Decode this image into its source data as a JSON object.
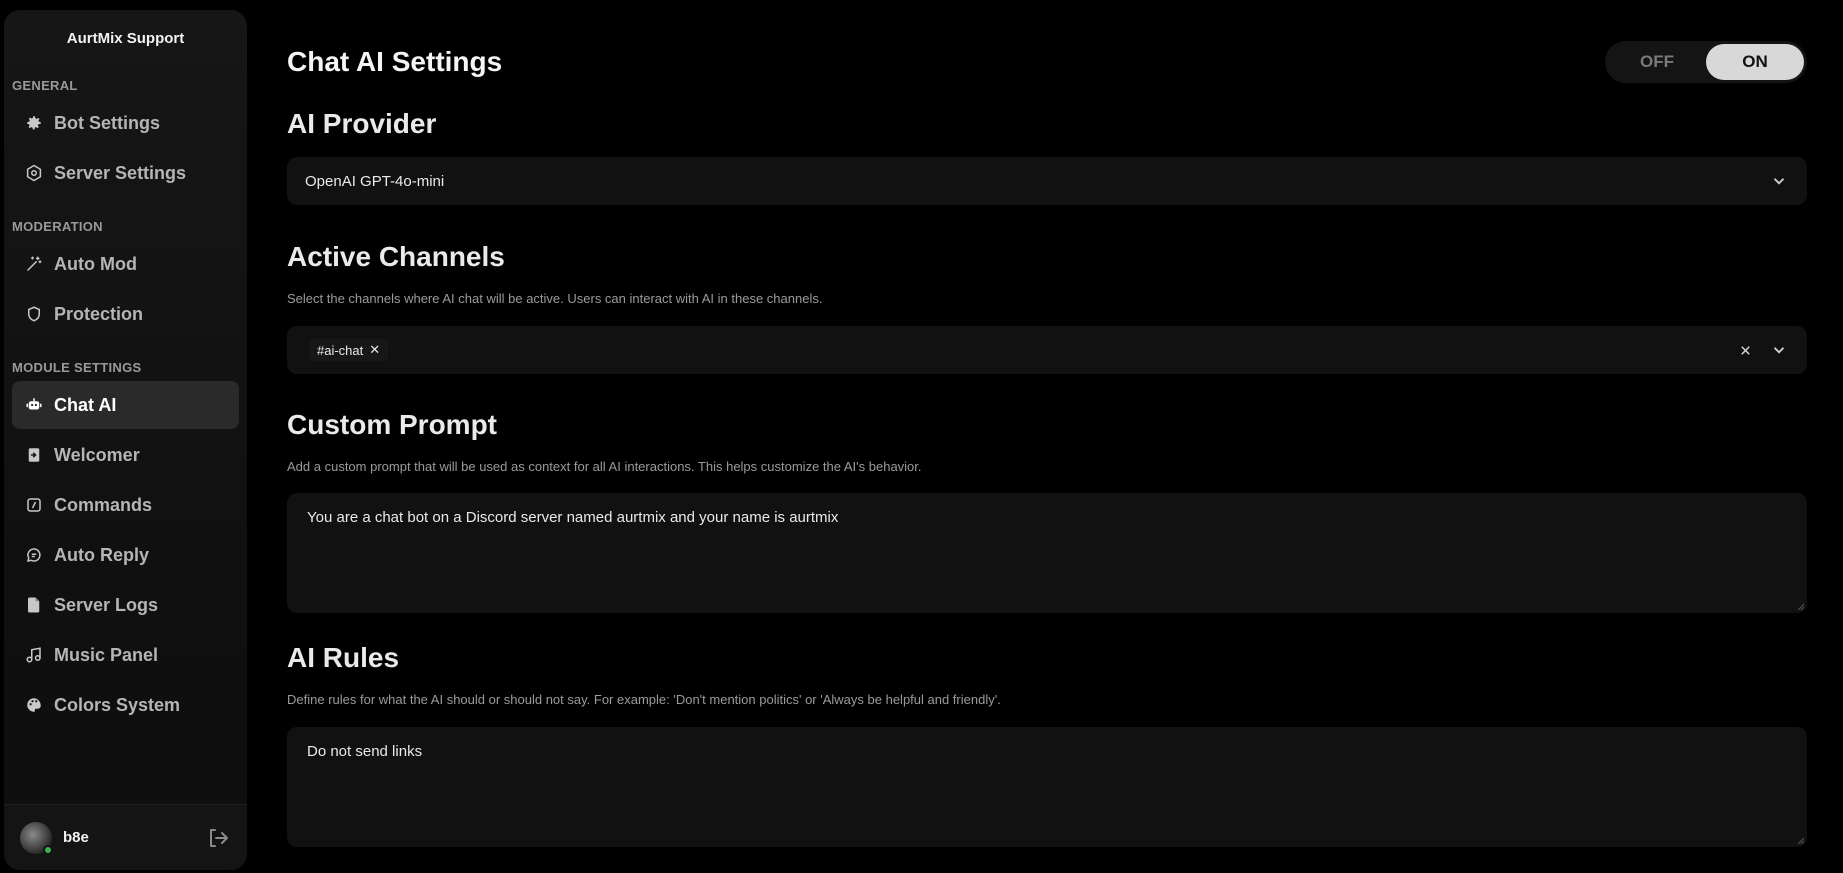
{
  "sidebar": {
    "brand": "AurtMix Support",
    "sections": {
      "general": "GENERAL",
      "moderation": "MODERATION",
      "module_settings": "MODULE SETTINGS"
    },
    "items": {
      "bot_settings": "Bot Settings",
      "server_settings": "Server Settings",
      "auto_mod": "Auto Mod",
      "protection": "Protection",
      "chat_ai": "Chat AI",
      "welcomer": "Welcomer",
      "commands": "Commands",
      "auto_reply": "Auto Reply",
      "server_logs": "Server Logs",
      "music_panel": "Music Panel",
      "colors_system": "Colors System"
    },
    "user": {
      "name": "b8e",
      "status_color": "#3bb54a"
    }
  },
  "main": {
    "title": "Chat AI Settings",
    "toggle": {
      "off_label": "OFF",
      "on_label": "ON",
      "state": "ON"
    },
    "provider": {
      "title": "AI Provider",
      "selected": "OpenAI GPT-4o-mini"
    },
    "channels": {
      "title": "Active Channels",
      "description": "Select the channels where AI chat will be active. Users can interact with AI in these channels.",
      "chip": "#ai-chat"
    },
    "prompt": {
      "title": "Custom Prompt",
      "description": "Add a custom prompt that will be used as context for all AI interactions. This helps customize the AI's behavior.",
      "value": "You are a chat bot on a Discord server named aurtmix and your name is aurtmix"
    },
    "rules": {
      "title": "AI Rules",
      "description": "Define rules for what the AI should or should not say. For example: 'Don't mention politics' or 'Always be helpful and friendly'.",
      "value": "Do not send links"
    }
  },
  "colors": {
    "background": "#000000",
    "panel": "#111111",
    "active_item": "#2a2a2a",
    "toggle_on": "#d8d8d8",
    "status_online": "#3bb54a"
  }
}
